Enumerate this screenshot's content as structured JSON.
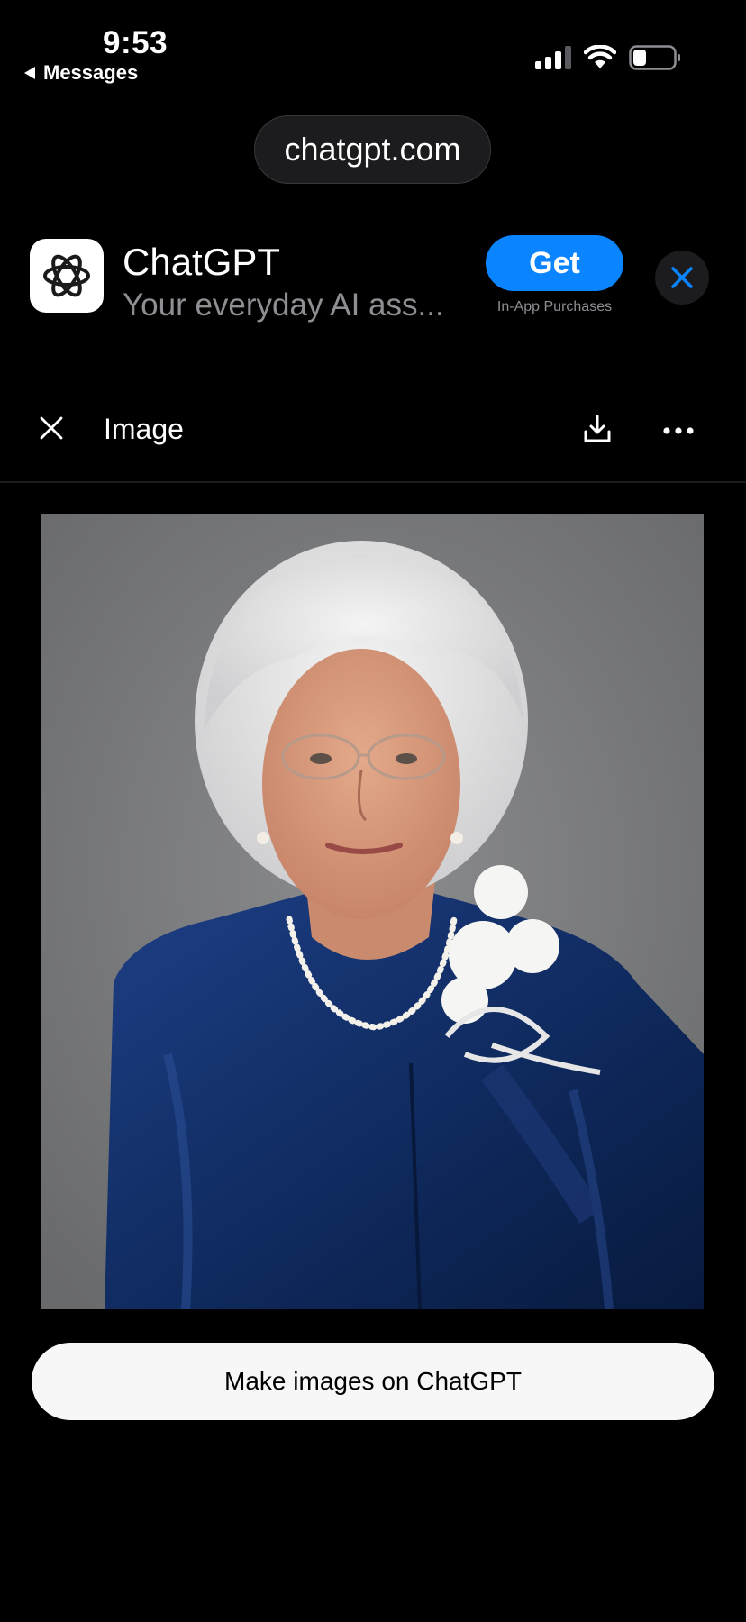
{
  "status_bar": {
    "time": "9:53",
    "back_label": "Messages",
    "icons": [
      "cellular-signal-icon",
      "wifi-icon",
      "battery-icon"
    ]
  },
  "browser": {
    "url": "chatgpt.com"
  },
  "app_banner": {
    "app_name": "ChatGPT",
    "subtitle": "Your everyday AI ass...",
    "get_label": "Get",
    "iap_note": "In-App Purchases",
    "icon": "openai-logo-icon",
    "accent_color": "#0a84ff"
  },
  "viewer": {
    "title": "Image",
    "icons": [
      "close-icon",
      "download-icon",
      "more-icon"
    ]
  },
  "cta": {
    "label": "Make images on ChatGPT"
  },
  "colors": {
    "background": "#000000",
    "photo_backdrop": "#7b7c7e",
    "jacket": "#0f2a5e"
  }
}
